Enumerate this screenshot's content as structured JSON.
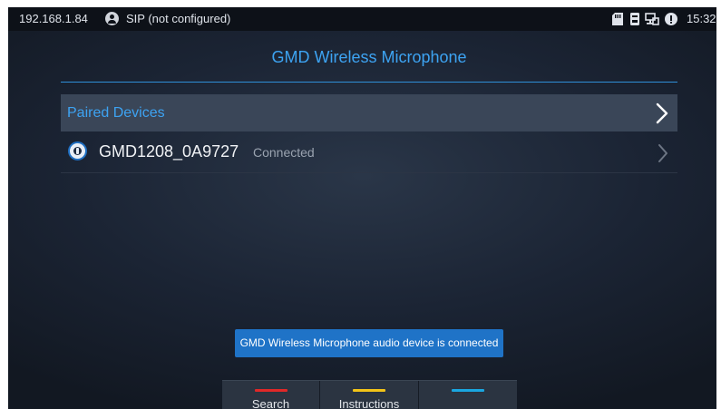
{
  "status_bar": {
    "ip": "192.168.1.84",
    "sip_status": "SIP (not configured)",
    "time": "15:32",
    "icons": [
      "sd-card-icon",
      "storage-icon",
      "network-icon",
      "info-icon"
    ]
  },
  "page": {
    "title": "GMD Wireless Microphone"
  },
  "paired_section": {
    "label": "Paired Devices"
  },
  "devices": [
    {
      "name": "GMD1208_0A9727",
      "status": "Connected",
      "icon": "microphone-icon"
    }
  ],
  "toast": {
    "message": "GMD Wireless Microphone audio device is connected"
  },
  "softkeys": [
    {
      "label": "Search",
      "color": "#e02828"
    },
    {
      "label": "Instructions",
      "color": "#f2c318"
    },
    {
      "label": "",
      "color": "#1aa6e0"
    }
  ],
  "colors": {
    "accent": "#3da3f2",
    "toast_bg": "#1f73c7"
  }
}
